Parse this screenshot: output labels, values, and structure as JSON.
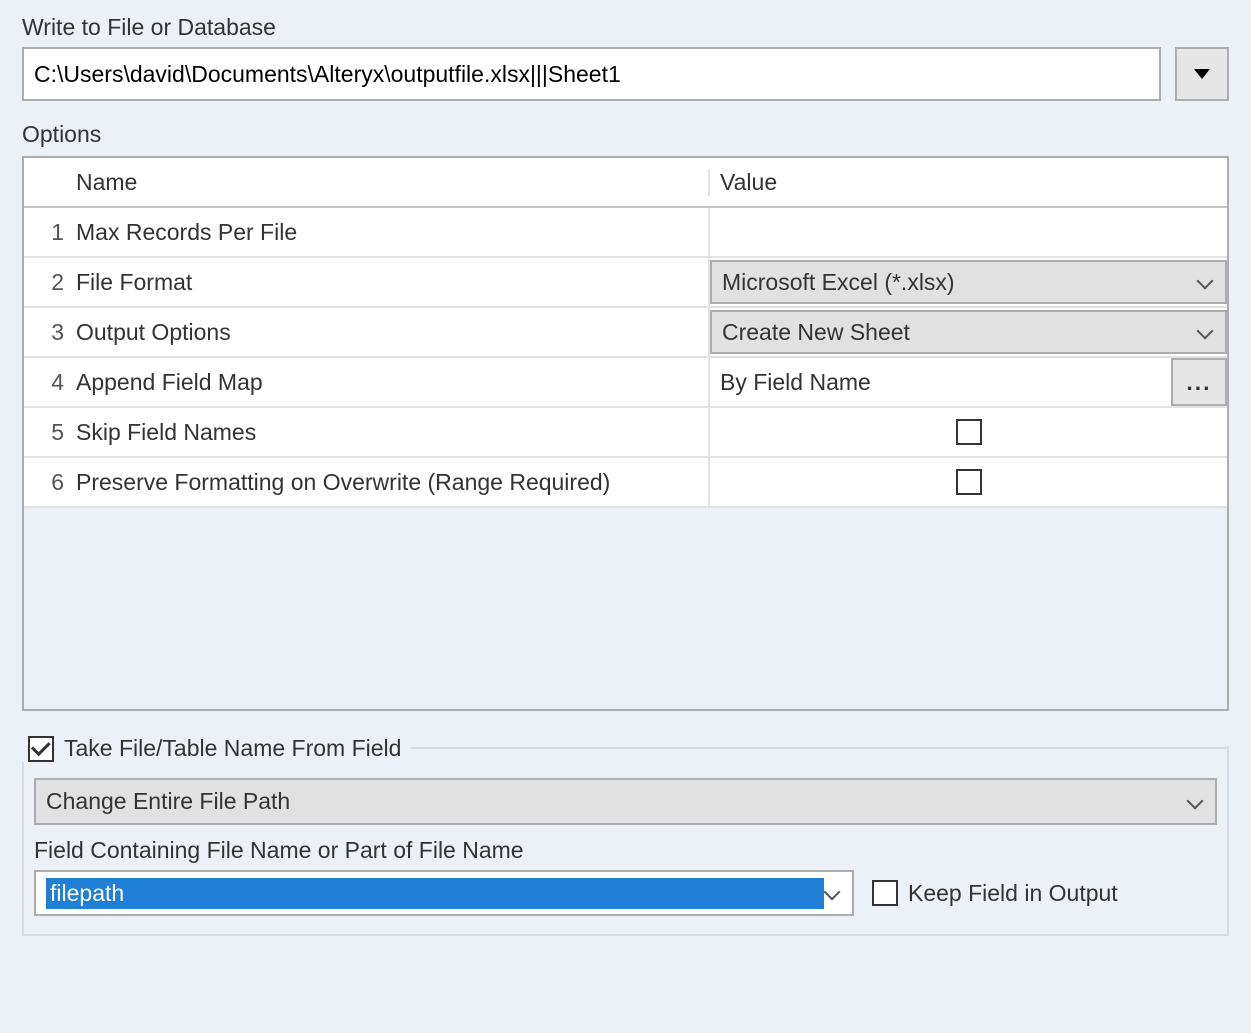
{
  "labels": {
    "write_to": "Write to File or Database",
    "options": "Options",
    "name_col": "Name",
    "value_col": "Value",
    "take_from_field": "Take File/Table Name From Field",
    "field_sub_label": "Field Containing File Name or Part of File Name",
    "keep_field": "Keep Field in Output"
  },
  "connection": {
    "value": "C:\\Users\\david\\Documents\\Alteryx\\outputfile.xlsx|||Sheet1"
  },
  "options_rows": [
    {
      "n": "1",
      "name": "Max Records Per File",
      "type": "text",
      "value": ""
    },
    {
      "n": "2",
      "name": "File Format",
      "type": "dropdown",
      "value": "Microsoft Excel (*.xlsx)"
    },
    {
      "n": "3",
      "name": "Output Options",
      "type": "dropdown",
      "value": "Create New Sheet"
    },
    {
      "n": "4",
      "name": "Append Field Map",
      "type": "text-browse",
      "value": "By Field Name"
    },
    {
      "n": "5",
      "name": "Skip Field Names",
      "type": "checkbox",
      "checked": false
    },
    {
      "n": "6",
      "name": "Preserve Formatting on Overwrite (Range Required)",
      "type": "checkbox",
      "checked": false
    }
  ],
  "take": {
    "enabled": true,
    "path_mode": "Change Entire File Path",
    "field_name": "filepath",
    "keep_field": false
  },
  "glyphs": {
    "ellipsis": "..."
  }
}
